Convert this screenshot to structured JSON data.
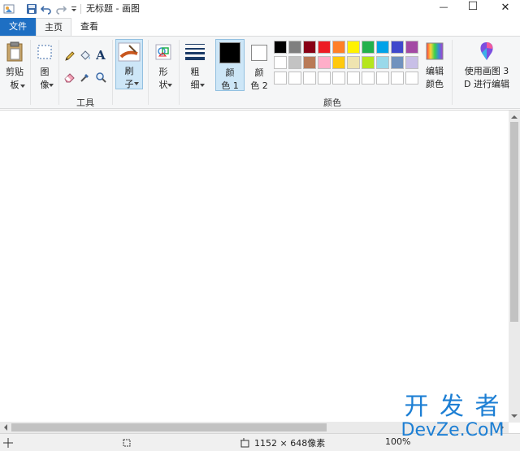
{
  "window": {
    "title": "无标题 - 画图",
    "minimize": "—",
    "maximize": "☐",
    "close": "✕"
  },
  "tabs": {
    "file": "文件",
    "home": "主页",
    "view": "查看"
  },
  "clipboard": {
    "line1": "剪贴",
    "line2": "板"
  },
  "image": {
    "line1": "图",
    "line2": "像"
  },
  "tools": {
    "group_label": "工具",
    "text_glyph": "A"
  },
  "brushes": {
    "line1": "刷",
    "line2": "子"
  },
  "shapes": {
    "line1": "形",
    "line2": "状"
  },
  "size": {
    "line1": "粗",
    "line2": "细"
  },
  "color1": {
    "line1": "颜",
    "line2": "色 1"
  },
  "color2": {
    "line1": "颜",
    "line2": "色 2"
  },
  "colors": {
    "group_label": "颜色",
    "row1": [
      "#000000",
      "#7f7f7f",
      "#880015",
      "#ed1c24",
      "#ff7f27",
      "#fff200",
      "#22b14c",
      "#00a2e8",
      "#3f48cc",
      "#a349a4"
    ],
    "row2": [
      "#ffffff",
      "#c3c3c3",
      "#b97a57",
      "#ffaec9",
      "#ffc90e",
      "#efe4b0",
      "#b5e61d",
      "#99d9ea",
      "#7092be",
      "#c8bfe7"
    ],
    "row3": [
      "#ffffff",
      "#ffffff",
      "#ffffff",
      "#ffffff",
      "#ffffff",
      "#ffffff",
      "#ffffff",
      "#ffffff",
      "#ffffff",
      "#ffffff"
    ],
    "primary": "#000000",
    "secondary": "#ffffff"
  },
  "edit_colors": {
    "line1": "编辑",
    "line2": "颜色"
  },
  "paint3d": {
    "line1": "使用画图 3",
    "line2": "D 进行编辑"
  },
  "status": {
    "dimensions": "1152 × 648像素",
    "zoom": "100%"
  },
  "watermark": {
    "line1": "开 发 者",
    "line2": "DevZe.CoM"
  }
}
